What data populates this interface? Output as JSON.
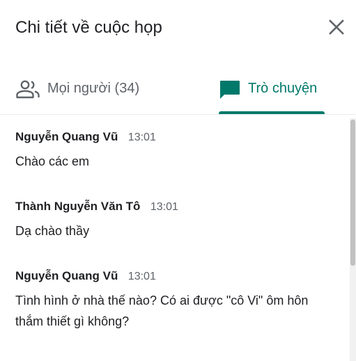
{
  "header": {
    "title": "Chi tiết về cuộc họp",
    "close_icon": "close-icon"
  },
  "tabs": [
    {
      "label": "Mọi người (34)",
      "icon": "people-icon",
      "selected": false
    },
    {
      "label": "Trò chuyện",
      "icon": "chat-icon",
      "selected": true
    }
  ],
  "colors": {
    "accent": "#00796b",
    "text_primary": "#202124",
    "text_secondary": "#5f6368"
  },
  "messages": [
    {
      "sender": "Nguyễn Quang Vũ",
      "time": "13:01",
      "text": "Chào các em"
    },
    {
      "sender": "Thành Nguyễn Văn Tô",
      "time": "13:01",
      "text": "Dạ chào thầy"
    },
    {
      "sender": "Nguyễn Quang Vũ",
      "time": "13:01",
      "text": "Tình hình ở nhà thế nào? Có ai được \"cô Vi\" ôm hôn thắm thiết gì không?"
    }
  ]
}
